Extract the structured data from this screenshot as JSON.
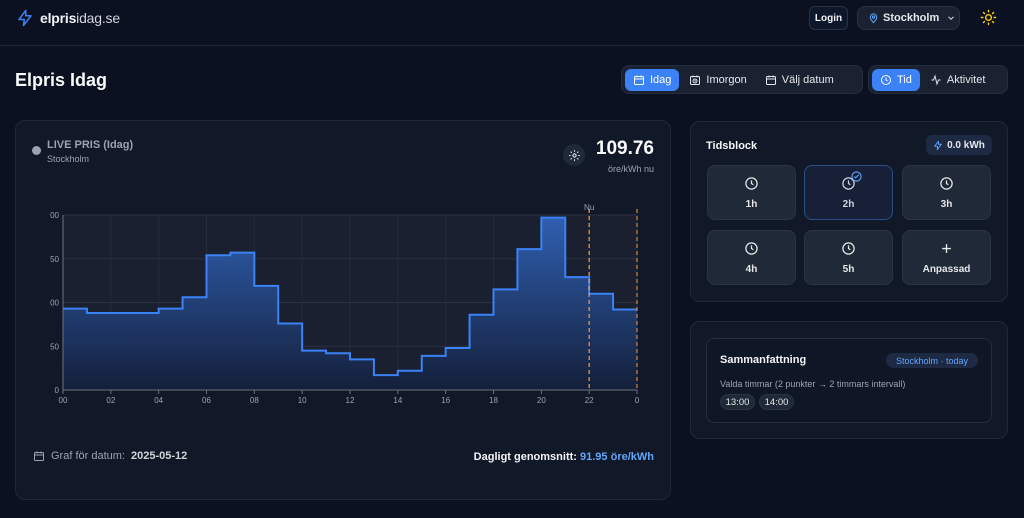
{
  "header": {
    "logo_bold": "elpris",
    "logo_light": "idag.se",
    "login_label": "Login",
    "city": "Stockholm"
  },
  "page": {
    "title": "Elpris Idag"
  },
  "day_tabs": [
    {
      "label": "Idag",
      "icon": "calendar-icon",
      "active": true
    },
    {
      "label": "Imorgon",
      "icon": "calendar-clock-icon",
      "active": false
    },
    {
      "label": "Välj datum",
      "icon": "calendar-icon",
      "active": false
    }
  ],
  "view_tabs": [
    {
      "label": "Tid",
      "icon": "clock-icon",
      "active": true
    },
    {
      "label": "Aktivitet",
      "icon": "activity-icon",
      "active": false
    }
  ],
  "live": {
    "label": "LIVE PRIS (Idag)",
    "city": "Stockholm",
    "price": "109.76",
    "unit": "öre/kWh nu"
  },
  "chart_data": {
    "type": "area",
    "step": true,
    "x": [
      0,
      1,
      2,
      3,
      4,
      5,
      6,
      7,
      8,
      9,
      10,
      11,
      12,
      13,
      14,
      15,
      16,
      17,
      18,
      19,
      20,
      21,
      22,
      23
    ],
    "values": [
      93,
      88,
      88,
      88,
      93,
      106,
      154,
      157,
      119,
      76,
      45,
      42,
      35,
      17,
      22,
      39,
      48,
      86,
      115,
      161,
      197,
      129,
      110,
      92
    ],
    "ylim": [
      0,
      200
    ],
    "yticks": [
      0,
      50,
      100,
      150,
      200
    ],
    "ytick_labels": [
      "0",
      "50",
      "00",
      "50",
      "00"
    ],
    "xticks": [
      0,
      2,
      4,
      6,
      8,
      10,
      12,
      14,
      16,
      18,
      20,
      22,
      24
    ],
    "xtick_labels": [
      "00",
      "02",
      "04",
      "06",
      "08",
      "10",
      "12",
      "14",
      "16",
      "18",
      "20",
      "22",
      "0"
    ],
    "now_marker": {
      "x": 22.0,
      "label": "Nu"
    },
    "end_marker": {
      "x": 24
    },
    "grid": true,
    "colors": {
      "line": "#3b82f6",
      "fill_top": "#2f5fb0",
      "fill_bottom": "#141f3a",
      "marker": "#f59e42"
    }
  },
  "footer": {
    "date_label": "Graf för datum:",
    "date_value": "2025-05-12",
    "avg_label": "Dagligt genomsnitt:",
    "avg_value": "91.95 öre/kWh"
  },
  "tidsblock": {
    "title": "Tidsblock",
    "kwh": "0.0 kWh",
    "tiles": [
      {
        "label": "1h",
        "icon": "clock-icon",
        "selected": false
      },
      {
        "label": "2h",
        "icon": "clock-icon",
        "selected": true
      },
      {
        "label": "3h",
        "icon": "clock-icon",
        "selected": false
      },
      {
        "label": "4h",
        "icon": "clock-icon",
        "selected": false
      },
      {
        "label": "5h",
        "icon": "clock-icon",
        "selected": false
      },
      {
        "label": "Anpassad",
        "icon": "plus-icon",
        "selected": false
      }
    ]
  },
  "summary": {
    "title": "Sammanfattning",
    "badge": "Stockholm · today",
    "text": "Valda timmar (2 punkter → 2 timmars intervall)",
    "chips": [
      "13:00",
      "14:00"
    ]
  }
}
